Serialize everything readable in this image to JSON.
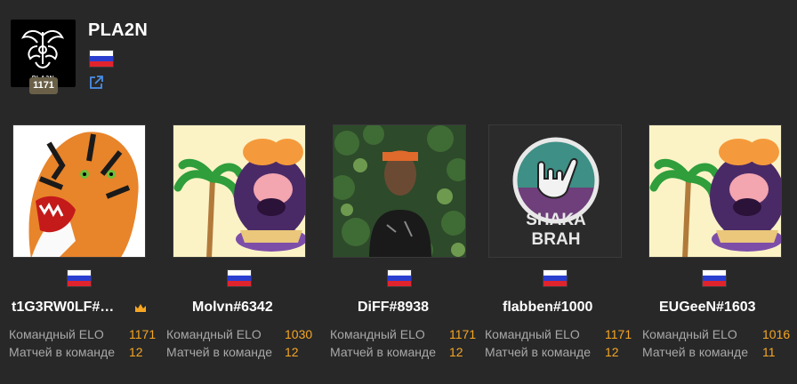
{
  "team": {
    "name": "PLA2N",
    "logo_text": "PLA2N",
    "elo_badge": "1171",
    "flag": "russia-flag",
    "external_link_icon": "external-link-icon"
  },
  "stat_labels": {
    "elo": "Командный ELO",
    "matches": "Матчей в команде"
  },
  "players": [
    {
      "name": "t1G3RW0LF#…",
      "elo": "1171",
      "matches": "12",
      "leader": true,
      "avatar": "tiger-avatar"
    },
    {
      "name": "Molvn#6342",
      "elo": "1030",
      "matches": "12",
      "leader": false,
      "avatar": "caveman-avatar"
    },
    {
      "name": "DiFF#8938",
      "elo": "1171",
      "matches": "12",
      "leader": false,
      "avatar": "photo-avatar"
    },
    {
      "name": "flabben#1000",
      "elo": "1171",
      "matches": "12",
      "leader": false,
      "avatar": "shaka-brah-avatar"
    },
    {
      "name": "EUGeeN#1603",
      "elo": "1016",
      "matches": "11",
      "leader": false,
      "avatar": "caveman-avatar"
    }
  ],
  "shaka_text": "SHAKA BRAH",
  "colors": {
    "background": "#282828",
    "accent": "#f6a623",
    "muted_text": "#a8a8a8",
    "link": "#4a8fe7"
  }
}
